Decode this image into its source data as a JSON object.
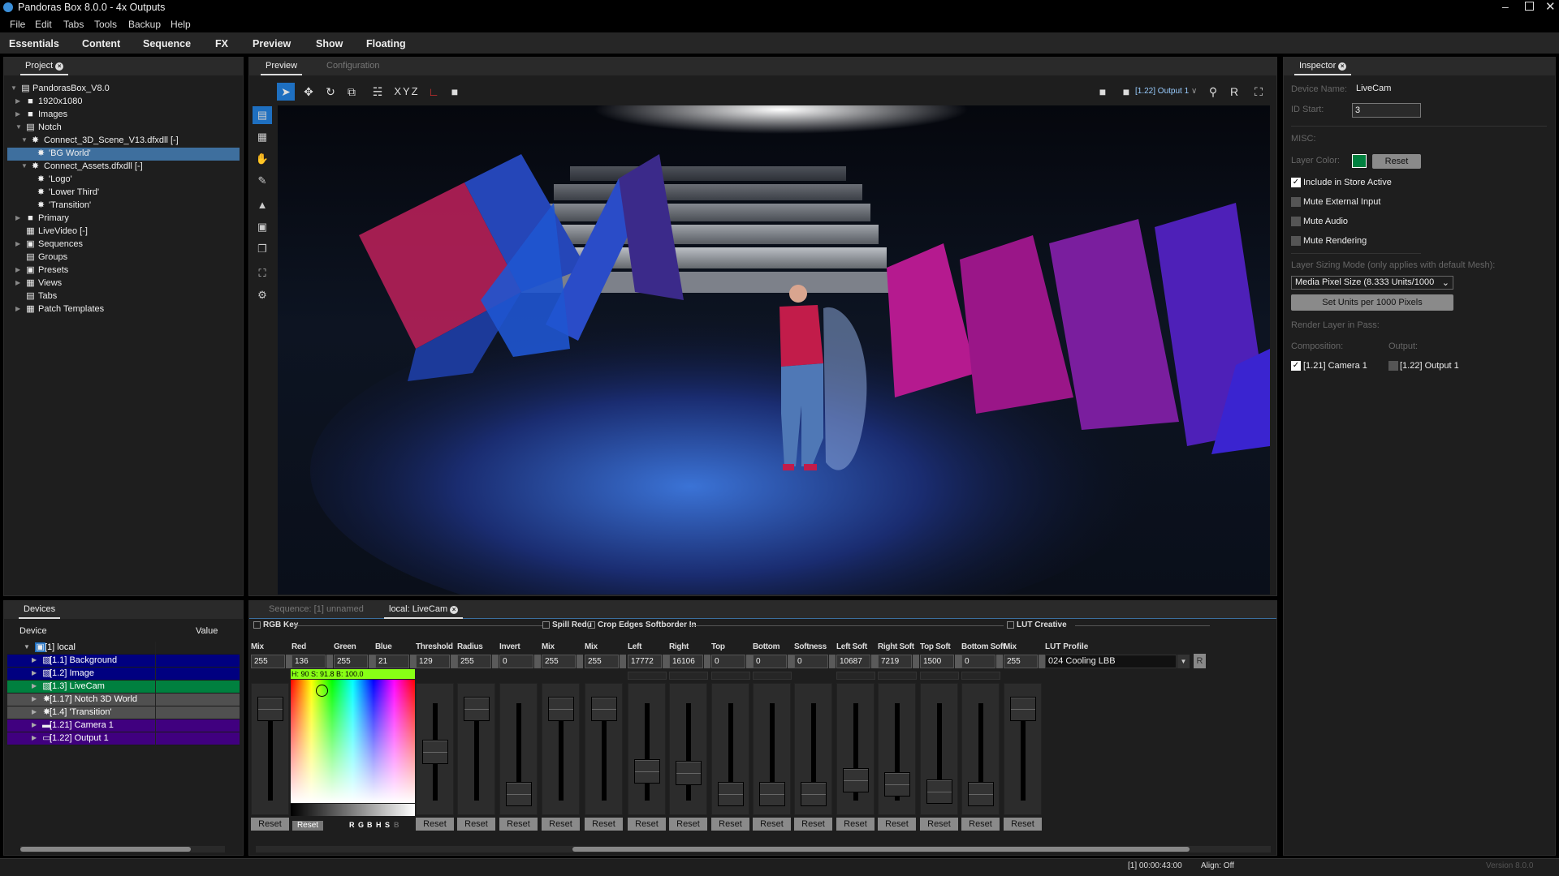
{
  "window": {
    "title": "Pandoras Box 8.0.0 - 4x Outputs"
  },
  "menu": [
    "File",
    "Edit",
    "Tabs",
    "Tools",
    "Backup",
    "Help"
  ],
  "main_tabs": [
    "Essentials",
    "Content",
    "Sequence",
    "FX",
    "Preview",
    "Show",
    "Floating"
  ],
  "project": {
    "tab": "Project",
    "tree": [
      {
        "label": "PandorasBox_V8.0",
        "level": 0,
        "arrow": "open",
        "icon": "folder-open"
      },
      {
        "label": "1920x1080",
        "level": 1,
        "arrow": "closed",
        "icon": "folder"
      },
      {
        "label": "Images",
        "level": 1,
        "arrow": "closed",
        "icon": "folder"
      },
      {
        "label": "Notch",
        "level": 1,
        "arrow": "open",
        "icon": "folder-open"
      },
      {
        "label": "Connect_3D_Scene_V13.dfxdll [-]",
        "level": 2,
        "arrow": "open",
        "icon": "notch"
      },
      {
        "label": "'BG World'",
        "level": 3,
        "arrow": "",
        "icon": "notch",
        "selected": true
      },
      {
        "label": "Connect_Assets.dfxdll [-]",
        "level": 2,
        "arrow": "open",
        "icon": "notch"
      },
      {
        "label": "'Logo'",
        "level": 3,
        "arrow": "",
        "icon": "notch"
      },
      {
        "label": "'Lower Third'",
        "level": 3,
        "arrow": "",
        "icon": "notch"
      },
      {
        "label": "'Transition'",
        "level": 3,
        "arrow": "",
        "icon": "notch"
      },
      {
        "label": "Primary",
        "level": 1,
        "arrow": "closed",
        "icon": "folder"
      },
      {
        "label": "LiveVideo [-]",
        "level": 1,
        "arrow": "",
        "icon": "film"
      },
      {
        "label": "Sequences",
        "level": 1,
        "arrow": "closed",
        "icon": "sequences"
      },
      {
        "label": "Groups",
        "level": 1,
        "arrow": "",
        "icon": "groups"
      },
      {
        "label": "Presets",
        "level": 1,
        "arrow": "closed",
        "icon": "presets"
      },
      {
        "label": "Views",
        "level": 1,
        "arrow": "closed",
        "icon": "views"
      },
      {
        "label": "Tabs",
        "level": 1,
        "arrow": "",
        "icon": "tabs"
      },
      {
        "label": "Patch Templates",
        "level": 1,
        "arrow": "closed",
        "icon": "patch"
      }
    ]
  },
  "preview": {
    "tabs": [
      "Preview",
      "Configuration"
    ],
    "xyz": "XYZ",
    "output_select": "[1.22] Output 1",
    "r_label": "R"
  },
  "inspector": {
    "tab": "Inspector",
    "device_name_label": "Device Name:",
    "device_name": "LiveCam",
    "id_start_label": "ID Start:",
    "id_start": "3",
    "misc": "MISC:",
    "layer_color_label": "Layer Color:",
    "layer_color": "#00803f",
    "reset": "Reset",
    "checks": [
      {
        "label": "Include in Store Active",
        "checked": true
      },
      {
        "label": "Mute External Input",
        "checked": false
      },
      {
        "label": "Mute Audio",
        "checked": false
      },
      {
        "label": "Mute Rendering",
        "checked": false
      }
    ],
    "sizing_label": "Layer Sizing Mode (only applies with default Mesh):",
    "sizing_value": "Media Pixel Size (8.333 Units/1000",
    "set_units": "Set Units per 1000 Pixels",
    "render_pass": "Render Layer in Pass:",
    "composition": "Composition:",
    "output": "Output:",
    "camera": {
      "label": "[1.21] Camera 1",
      "checked": true
    },
    "output_item": {
      "label": "[1.22] Output 1",
      "checked": false
    }
  },
  "devices": {
    "tab": "Devices",
    "col_device": "Device",
    "col_value": "Value",
    "rows": [
      {
        "label": "[1] local",
        "color": "#1e1e1e",
        "icon": "server",
        "arrow": "open"
      },
      {
        "label": "[1.1] Background",
        "color": "#000080",
        "icon": "layer"
      },
      {
        "label": "[1.2] Image",
        "color": "#000080",
        "icon": "layer"
      },
      {
        "label": "[1.3] LiveCam",
        "color": "#00803f",
        "icon": "layer"
      },
      {
        "label": "[1.17] Notch 3D World",
        "color": "#505050",
        "icon": "notch"
      },
      {
        "label": "[1.4] 'Transition'",
        "color": "#505050",
        "icon": "notch"
      },
      {
        "label": "[1.21] Camera 1",
        "color": "#40007f",
        "icon": "camera"
      },
      {
        "label": "[1.22] Output 1",
        "color": "#40007f",
        "icon": "monitor"
      }
    ]
  },
  "fx": {
    "tabs": [
      "Sequence: [1] unnamed",
      "local: LiveCam"
    ],
    "sections": [
      "RGB Key",
      "Spill Redu",
      "Crop Edges Softborder In",
      "LUT Creative"
    ],
    "hsb": "H: 90  S: 91.8  B: 100.0",
    "key_color": "#88ff15",
    "picker_buttons": [
      "R",
      "G",
      "B",
      "H",
      "S",
      "B"
    ],
    "reset": "Reset",
    "params": [
      {
        "label": "Mix",
        "value": "255",
        "level": 1
      },
      {
        "label": "Red",
        "value": "136"
      },
      {
        "label": "Green",
        "value": "255"
      },
      {
        "label": "Blue",
        "value": "21"
      },
      {
        "label": "Threshold",
        "value": "129",
        "level": 0.5
      },
      {
        "label": "Radius",
        "value": "255",
        "level": 1
      },
      {
        "label": "Invert",
        "value": "0",
        "level": 0
      },
      {
        "label": "Mix",
        "value": "255",
        "level": 1
      },
      {
        "label": "Mix",
        "value": "255",
        "level": 1
      },
      {
        "label": "Left",
        "value": "17772",
        "level": 0.27,
        "link": true
      },
      {
        "label": "Right",
        "value": "16106",
        "level": 0.25,
        "link": true
      },
      {
        "label": "Top",
        "value": "0",
        "level": 0,
        "link": true
      },
      {
        "label": "Bottom",
        "value": "0",
        "level": 0,
        "link": true
      },
      {
        "label": "Softness",
        "value": "0",
        "level": 0
      },
      {
        "label": "Left Soft",
        "value": "10687",
        "level": 0.16,
        "link": true
      },
      {
        "label": "Right Soft",
        "value": "7219",
        "level": 0.11,
        "link": true
      },
      {
        "label": "Top Soft",
        "value": "1500",
        "level": 0.03,
        "link": true
      },
      {
        "label": "Bottom Soft",
        "value": "0",
        "level": 0,
        "link": true
      },
      {
        "label": "Mix",
        "value": "255",
        "level": 1
      }
    ],
    "lut": {
      "label": "LUT Profile",
      "value": "024 Cooling LBB",
      "r": "R"
    }
  },
  "status": {
    "time": "[1] 00:00:43:00",
    "align": "Align: Off",
    "version": "Version 8.0.0"
  }
}
